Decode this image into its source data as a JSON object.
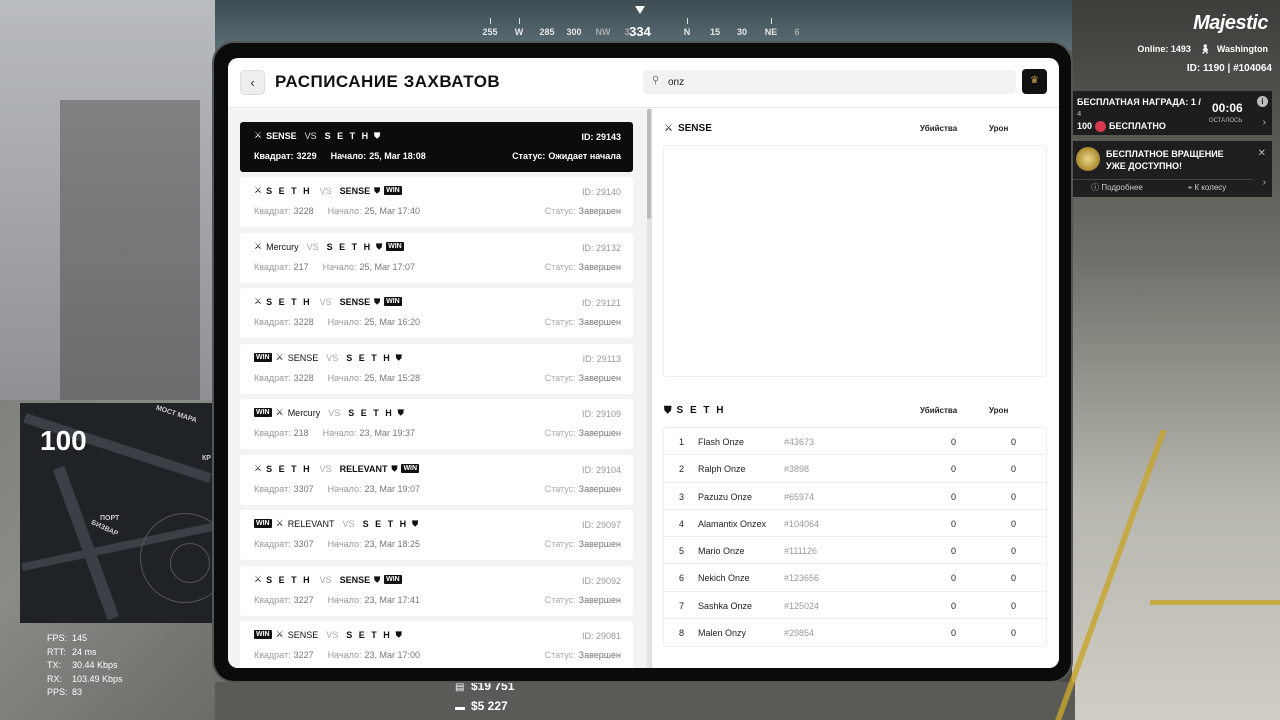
{
  "compass": {
    "ticks": [
      "255",
      "W",
      "285",
      "300",
      "NW",
      "3",
      "N",
      "15",
      "30",
      "NE",
      "6"
    ],
    "heading": "334"
  },
  "hud": {
    "brand": "Majestic",
    "online": "Online: 1493",
    "city": "Washington",
    "id_line": "ID: 1190 | #104064",
    "reward": {
      "title": "БЕСПЛАТНАЯ НАГРАДА: 1 /",
      "title2": "4",
      "value": "100",
      "value_label": "БЕСПЛАТНО",
      "timer": "00:06",
      "timer_label": "ОСТАЛОСЬ"
    },
    "spin": {
      "text1": "БЕСПЛАТНОЕ ВРАЩЕНИЕ",
      "text2": "УЖЕ ДОСТУПНО!",
      "more": "Подробнее",
      "wheel": "К колесу"
    },
    "speed": "100",
    "map_labels": [
      "МОСТ МАРА",
      "ПОРТ",
      "БИЗВАР",
      "КР"
    ],
    "net": [
      {
        "k": "FPS:",
        "v": "145"
      },
      {
        "k": "RTT:",
        "v": "24 ms"
      },
      {
        "k": "TX:",
        "v": "30.44 Kbps"
      },
      {
        "k": "RX:",
        "v": "103.49 Kbps"
      },
      {
        "k": "PPS:",
        "v": "83"
      }
    ],
    "money_cash": "$19 751",
    "money_bank": "$5 227"
  },
  "tablet": {
    "title": "РАСПИСАНИЕ ЗАХВАТОВ",
    "search_value": "onz",
    "labels": {
      "vs": "VS",
      "square": "Квадрат:",
      "start": "Начало:",
      "status": "Статус:",
      "id": "ID:",
      "win": "WIN",
      "kills": "Убийства",
      "damage": "Урон"
    },
    "captures": [
      {
        "a": "SENSE",
        "b": "S E T H",
        "id": "29143",
        "sq": "3229",
        "start": "25, Мar 18:08",
        "status": "Ожидает начала"
      },
      {
        "a": "S E T H",
        "b": "SENSE",
        "id": "29140",
        "sq": "3228",
        "start": "25, Мar 17:40",
        "status": "Завершен"
      },
      {
        "a": "Mercury",
        "b": "S E T H",
        "id": "29132",
        "sq": "217",
        "start": "25, Мar 17:07",
        "status": "Завершен"
      },
      {
        "a": "S E T H",
        "b": "SENSE",
        "id": "29121",
        "sq": "3228",
        "start": "25, Мar 16:20",
        "status": "Завершен"
      },
      {
        "a": "SENSE",
        "b": "S E T H",
        "id": "29113",
        "sq": "3228",
        "start": "25, Мar 15:28",
        "status": "Завершен"
      },
      {
        "a": "Mercury",
        "b": "S E T H",
        "id": "29109",
        "sq": "218",
        "start": "23, Мar 19:37",
        "status": "Завершен"
      },
      {
        "a": "S E T H",
        "b": "RELEVANT",
        "id": "29104",
        "sq": "3307",
        "start": "23, Мar 19:07",
        "status": "Завершен"
      },
      {
        "a": "RELEVANT",
        "b": "S E T H",
        "id": "29097",
        "sq": "3307",
        "start": "23, Мar 18:25",
        "status": "Завершен"
      },
      {
        "a": "S E T H",
        "b": "SENSE",
        "id": "29092",
        "sq": "3227",
        "start": "23, Мar 17:41",
        "status": "Завершен"
      },
      {
        "a": "SENSE",
        "b": "S E T H",
        "id": "29081",
        "sq": "3227",
        "start": "23, Мar 17:00",
        "status": "Завершен"
      }
    ],
    "team1": {
      "name": "SENSE"
    },
    "team2": {
      "name": "S E T H",
      "players": [
        {
          "n": "1",
          "name": "Flash Onze",
          "id": "#43673",
          "kills": "0",
          "dmg": "0"
        },
        {
          "n": "2",
          "name": "Ralph Onze",
          "id": "#3898",
          "kills": "0",
          "dmg": "0"
        },
        {
          "n": "3",
          "name": "Pazuzu Onze",
          "id": "#65974",
          "kills": "0",
          "dmg": "0"
        },
        {
          "n": "4",
          "name": "Alamantix Onzex",
          "id": "#104064",
          "kills": "0",
          "dmg": "0"
        },
        {
          "n": "5",
          "name": "Mario Onze",
          "id": "#111126",
          "kills": "0",
          "dmg": "0"
        },
        {
          "n": "6",
          "name": "Nekich Onze",
          "id": "#123656",
          "kills": "0",
          "dmg": "0"
        },
        {
          "n": "7",
          "name": "Sashka Onze",
          "id": "#125024",
          "kills": "0",
          "dmg": "0"
        },
        {
          "n": "8",
          "name": "Malen Onzy",
          "id": "#29854",
          "kills": "0",
          "dmg": "0"
        }
      ]
    }
  }
}
